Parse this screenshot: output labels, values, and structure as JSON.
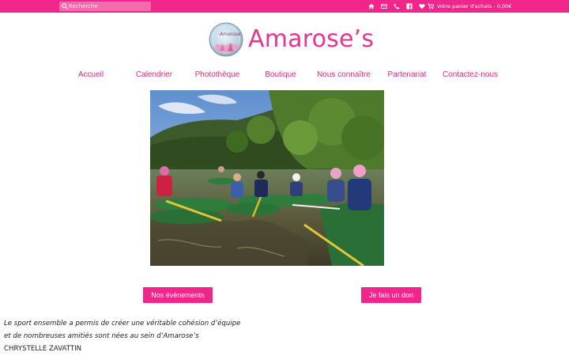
{
  "topbar": {
    "search_placeholder": "Recherche",
    "icons": [
      "home-icon",
      "mail-icon",
      "phone-icon",
      "facebook-icon",
      "heart-icon",
      "cart-icon"
    ],
    "cart_label": "Votre panier d'achats - 0,00€"
  },
  "brand": {
    "name": "Amarose’s",
    "logo_caption": "Amarose"
  },
  "nav": {
    "items": [
      {
        "label": "Accueil"
      },
      {
        "label": "Calendrier"
      },
      {
        "label": "Photothèque"
      },
      {
        "label": "Boutique"
      },
      {
        "label": "Nous connaître"
      },
      {
        "label": "Partenariat"
      },
      {
        "label": "Contactez-nous"
      }
    ]
  },
  "hero": {
    "image": "kayak-group-photo"
  },
  "buttons": {
    "events": "Nos événements",
    "donate": "Je fais un don"
  },
  "quote": {
    "line1": "Le sport ensemble a permis de créer une véritable cohésion d’équipe",
    "line2": "et de nombreuses amitiés sont nées au sein d’Amarose’s",
    "author": "CHRYSTELLE ZAVATTIN"
  },
  "colors": {
    "brand_pink": "#f0268a",
    "logo_pink": "#e8348e"
  }
}
